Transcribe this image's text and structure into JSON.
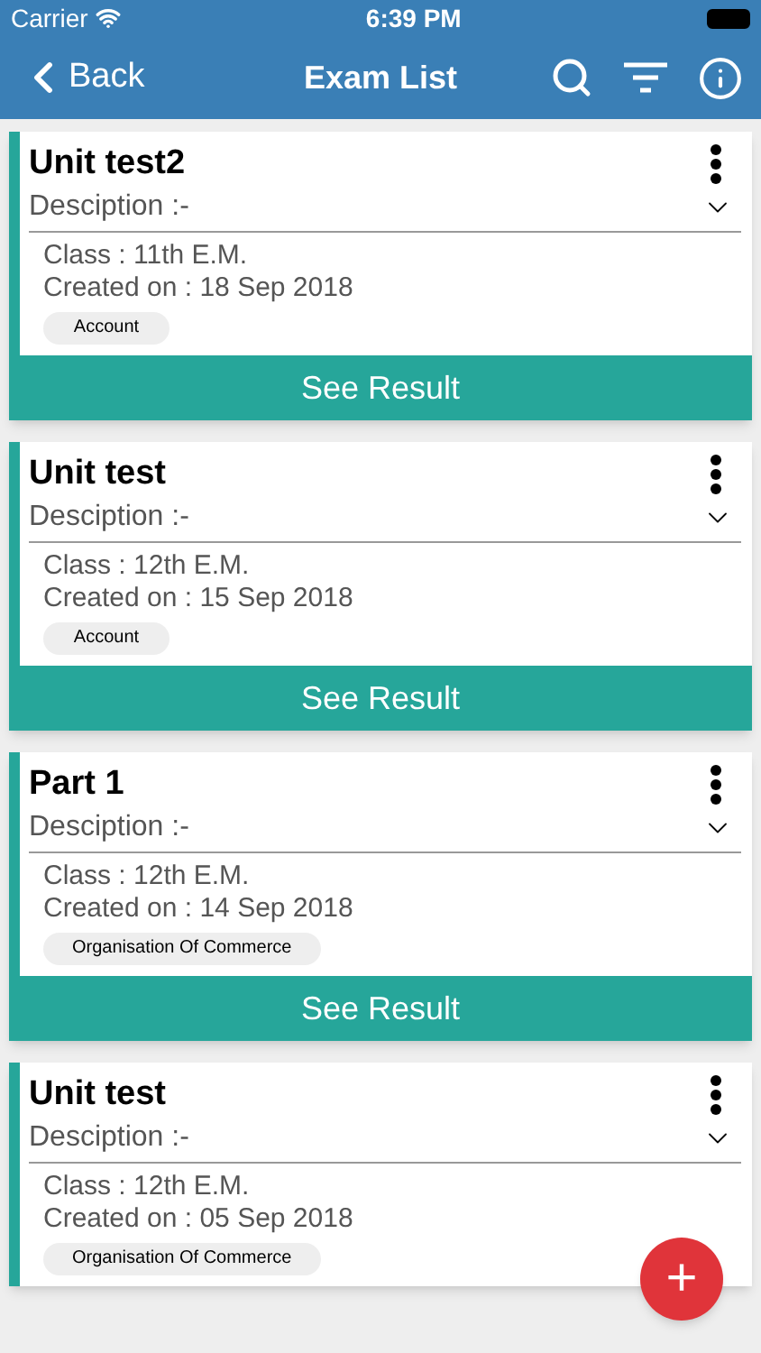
{
  "status_bar": {
    "carrier": "Carrier",
    "time": "6:39 PM"
  },
  "nav": {
    "back": "Back",
    "title": "Exam List"
  },
  "exams": [
    {
      "title": "Unit test2",
      "description": "Desciption :-",
      "class": "Class : 11th E.M.",
      "created": "Created on : 18 Sep 2018",
      "tag": "Account",
      "button": "See Result"
    },
    {
      "title": "Unit test",
      "description": "Desciption :-",
      "class": "Class : 12th E.M.",
      "created": "Created on : 15 Sep 2018",
      "tag": "Account",
      "button": "See Result"
    },
    {
      "title": "Part 1",
      "description": "Desciption :-",
      "class": "Class : 12th E.M.",
      "created": "Created on : 14 Sep 2018",
      "tag": "Organisation Of Commerce",
      "button": "See Result"
    },
    {
      "title": "Unit test",
      "description": "Desciption :-",
      "class": "Class : 12th E.M.",
      "created": "Created on : 05 Sep 2018",
      "tag": "Organisation Of Commerce"
    }
  ],
  "fab": "+"
}
